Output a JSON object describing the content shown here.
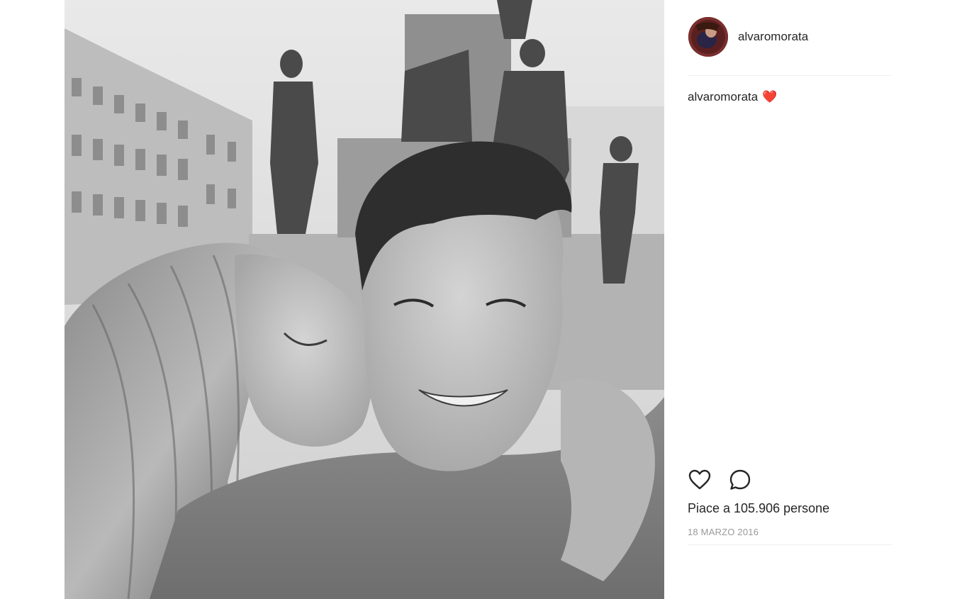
{
  "post": {
    "username": "alvaromorata",
    "caption_user": "alvaromorata",
    "caption_text": "❤️",
    "likes_text": "Piace a 105.906 persone",
    "date_text": "18 MARZO 2016"
  },
  "icons": {
    "like": "heart-outline-icon",
    "comment": "comment-bubble-icon"
  },
  "colors": {
    "text": "#262626",
    "muted": "#999999",
    "divider": "#efefef"
  }
}
